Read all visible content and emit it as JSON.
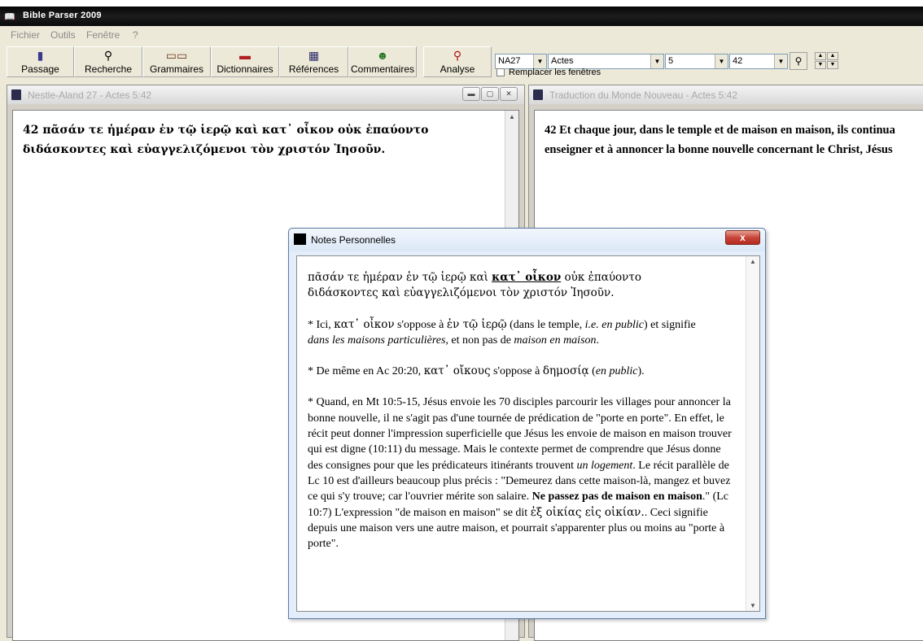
{
  "app": {
    "title": "Bible Parser 2009"
  },
  "menu": [
    "Fichier",
    "Outils",
    "Fenêtre",
    "?"
  ],
  "toolbar": {
    "buttons": [
      {
        "label": "Passage",
        "icon": "book-icon"
      },
      {
        "label": "Recherche",
        "icon": "search-book-icon"
      },
      {
        "label": "Grammaires",
        "icon": "books-icon"
      },
      {
        "label": "Dictionnaires",
        "icon": "dictionary-icon"
      },
      {
        "label": "Références",
        "icon": "references-icon"
      },
      {
        "label": "Commentaires",
        "icon": "commentary-icon"
      },
      {
        "label": "Analyse",
        "icon": "magnifier-icon"
      }
    ],
    "version_select": "NA27",
    "book_select": "Actes",
    "chapter_select": "5",
    "verse_select": "42",
    "replace_windows_label": "Remplacer les fenêtres",
    "replace_windows_checked": false
  },
  "left_window": {
    "title": "Nestle-Aland 27 - Actes 5:42",
    "line1": "42 πᾶσάν τε ἡμέραν ἐν τῷ ἱερῷ καὶ κατ᾽ οἶκον οὐκ ἐπαύοντο",
    "line2": "διδάσκοντες καὶ εὐαγγελιζόμενοι τὸν χριστόν Ἰησοῦν."
  },
  "right_window": {
    "title": "Traduction du Monde Nouveau - Actes 5:42",
    "line1": "42 Et chaque jour, dans le temple et de maison en maison, ils continua",
    "line2": "enseigner et à annoncer la bonne nouvelle concernant le Christ, Jésus"
  },
  "notes": {
    "title": "Notes Personnelles",
    "close_label": "x",
    "greek_a": "πᾶσάν τε ἡμέραν ἐν τῷ ἱερῷ καὶ ",
    "greek_bold": "κατ᾽ οἶκον",
    "greek_b": " οὐκ ἐπαύοντο",
    "greek_line2": "διδάσκοντες καὶ εὐαγγελιζόμενοι τὸν χριστόν Ἰησοῦν.",
    "p1_a": "* Ici, ",
    "p1_greek1": "κατ᾽ οἶκον",
    "p1_b": " s'oppose à ",
    "p1_greek2": "ἐν τῷ ἱερῷ",
    "p1_c": " (dans le temple, ",
    "p1_ie": "i.e. en public",
    "p1_d": ") et signifie",
    "p1_e": "dans les maisons particulières",
    "p1_f": ", et non pas de ",
    "p1_g": "maison en maison",
    "p1_h": ".",
    "p2_a": "* De même en Ac 20:20, ",
    "p2_greek1": "κατ᾽ οἴκους",
    "p2_b": " s'oppose à ",
    "p2_greek2": "δημοσίᾳ",
    "p2_c": " (",
    "p2_d": "en public",
    "p2_e": ").",
    "p3_a": "* Quand, en Mt 10:5-15, Jésus envoie les 70 disciples parcourir les villages pour annoncer la bonne nouvelle, il ne s'agit pas d'une tournée de prédication de \"porte en porte\". En effet, le récit peut donner l'impression superficielle que Jésus les envoie de maison en maison trouver qui est digne (10:11) du message. Mais le contexte permet de comprendre que Jésus donne des consignes pour que les prédicateurs itinérants trouvent ",
    "p3_b": "un logement",
    "p3_c": ". Le récit parallèle de Lc 10 est d'ailleurs beaucoup plus précis : \"Demeurez dans cette maison-là, mangez et buvez ce qui s'y trouve; car l'ouvrier mérite son salaire. ",
    "p3_d": "Ne passez pas de maison en maison",
    "p3_e": ".\" (Lc 10:7) L'expression \"de maison en maison\" se dit ",
    "p3_greek": "ἐξ οἰκίας εἰς οἰκίαν.",
    "p3_f": ". Ceci signifie depuis une maison vers une autre maison, et pourrait s'apparenter plus ou moins au \"porte à porte\"."
  }
}
